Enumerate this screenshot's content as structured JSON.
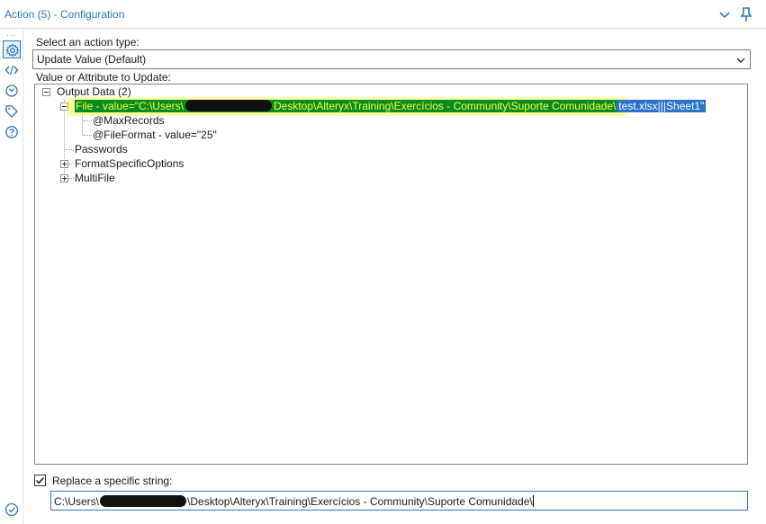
{
  "window": {
    "title": "Action (5) - Configuration"
  },
  "rail": {
    "dots": "...",
    "items": [
      "gear-icon",
      "code-icon",
      "refresh-icon",
      "tag-icon",
      "help-icon"
    ]
  },
  "form": {
    "action_type_label": "Select an action type:",
    "action_type_value": "Update Value (Default)",
    "tree_label": "Value or Attribute to Update:"
  },
  "tree": {
    "root": "Output Data (2)",
    "file_prefix": "File - value=\"C:\\Users\\",
    "file_middle": "Desktop\\Alteryx\\Training\\Exercícios - Community\\Suporte Comunidade\\",
    "file_suffix": "test.xlsx|||Sheet1\"",
    "max_records": "@MaxRecords",
    "file_format": "@FileFormat - value=\"25\"",
    "passwords": "Passwords",
    "format_specific": "FormatSpecificOptions",
    "multifile": "MultiFile"
  },
  "replace": {
    "label": "Replace a specific string:",
    "checked": true,
    "value_prefix": "C:\\Users\\",
    "value_suffix": "\\Desktop\\Alteryx\\Training\\Exercícios - Community\\Suporte Comunidade\\"
  },
  "colors": {
    "accent": "#2e77b8",
    "highlight_bg": "#0a8a22",
    "highlight_text": "#f6ff3c",
    "selection": "#2b73c8"
  }
}
